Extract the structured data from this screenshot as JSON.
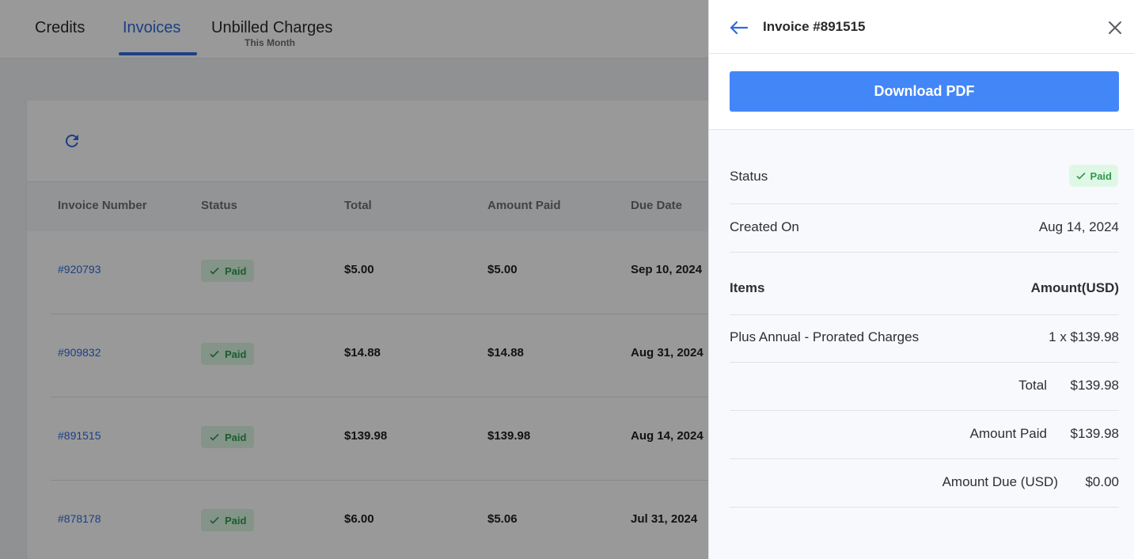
{
  "tabs": {
    "credits": "Credits",
    "invoices": "Invoices",
    "unbilled": "Unbilled Charges",
    "unbilled_sub": "This Month"
  },
  "table": {
    "headers": [
      "Invoice Number",
      "Status",
      "Total",
      "Amount Paid",
      "Due Date"
    ],
    "rows": [
      {
        "number": "#920793",
        "status": "Paid",
        "total": "$5.00",
        "paid": "$5.00",
        "due": "Sep 10, 2024"
      },
      {
        "number": "#909832",
        "status": "Paid",
        "total": "$14.88",
        "paid": "$14.88",
        "due": "Aug 31, 2024"
      },
      {
        "number": "#891515",
        "status": "Paid",
        "total": "$139.98",
        "paid": "$139.98",
        "due": "Aug 14, 2024"
      },
      {
        "number": "#878178",
        "status": "Paid",
        "total": "$6.00",
        "paid": "$5.06",
        "due": "Jul 31, 2024"
      }
    ]
  },
  "panel": {
    "title": "Invoice #891515",
    "download_label": "Download PDF",
    "status_label": "Status",
    "status_value": "Paid",
    "created_label": "Created On",
    "created_value": "Aug 14, 2024",
    "items_header": "Items",
    "amount_header": "Amount(USD)",
    "item_name": "Plus Annual - Prorated Charges",
    "item_amount": "1 x $139.98",
    "total_label": "Total",
    "total_value": "$139.98",
    "amount_paid_label": "Amount Paid",
    "amount_paid_value": "$139.98",
    "amount_due_label": "Amount Due (USD)",
    "amount_due_value": "$0.00"
  },
  "colors": {
    "accent": "#2f6bdc",
    "button": "#4386f7",
    "paid_bg": "#ddf7e3",
    "paid_text": "#2e9a4c"
  },
  "icons": {
    "back": "arrow-left-icon",
    "close": "close-icon",
    "refresh": "refresh-icon",
    "check": "check-icon"
  }
}
